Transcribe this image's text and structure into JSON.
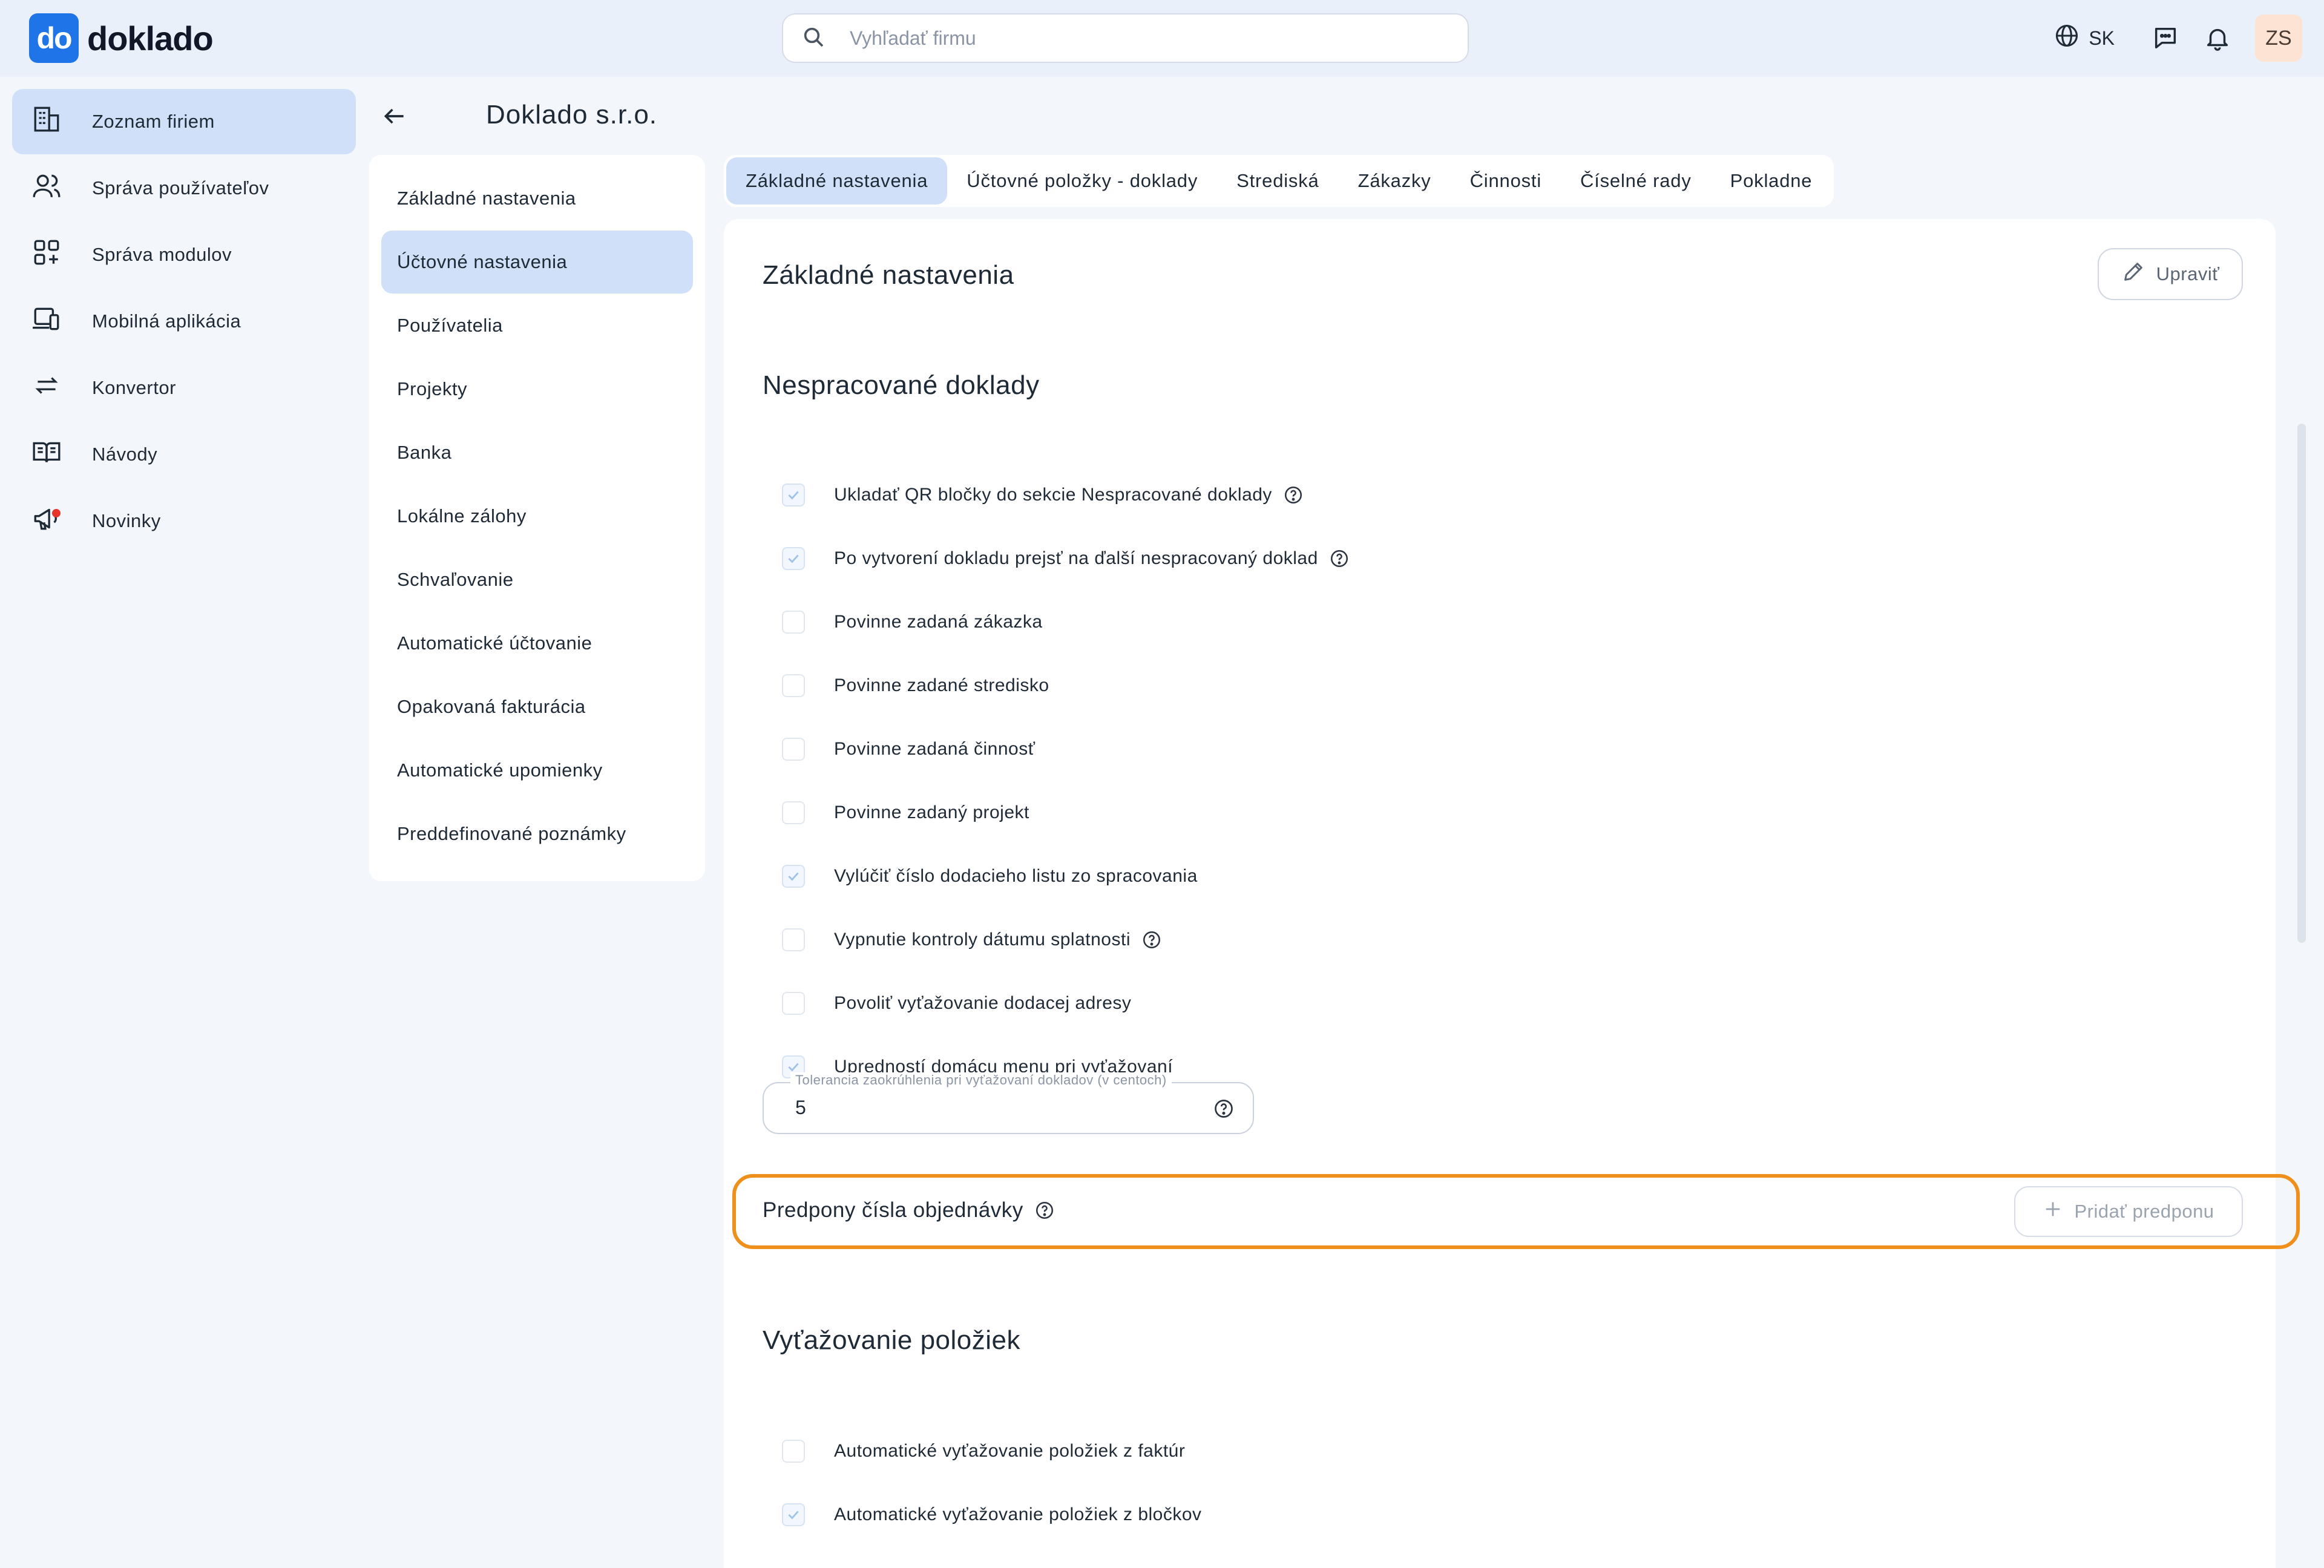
{
  "header": {
    "logo_mark": "do",
    "logo_text": "doklado",
    "search_placeholder": "Vyhľadať firmu",
    "language": "SK",
    "user_initials": "ZS",
    "icons": [
      "search-icon",
      "globe-icon",
      "chat-icon",
      "bell-icon"
    ]
  },
  "sidebar": {
    "items": [
      {
        "label": "Zoznam firiem",
        "icon": "building-icon",
        "active": true
      },
      {
        "label": "Správa používateľov",
        "icon": "users-icon"
      },
      {
        "label": "Správa modulov",
        "icon": "modules-icon"
      },
      {
        "label": "Mobilná aplikácia",
        "icon": "mobile-icon"
      },
      {
        "label": "Konvertor",
        "icon": "convert-icon"
      },
      {
        "label": "Návody",
        "icon": "book-icon"
      },
      {
        "label": "Novinky",
        "icon": "megaphone-icon"
      }
    ]
  },
  "page": {
    "title": "Doklado s.r.o."
  },
  "submenu": {
    "items": [
      "Základné nastavenia",
      "Účtovné nastavenia",
      "Používatelia",
      "Projekty",
      "Banka",
      "Lokálne zálohy",
      "Schvaľovanie",
      "Automatické účtovanie",
      "Opakovaná fakturácia",
      "Automatické upomienky",
      "Preddefinované poznámky"
    ],
    "active_index": 1
  },
  "tabs": {
    "items": [
      "Základné nastavenia",
      "Účtovné položky - doklady",
      "Strediská",
      "Zákazky",
      "Činnosti",
      "Číselné rady",
      "Pokladne"
    ],
    "active_index": 0
  },
  "main": {
    "title": "Základné nastavenia",
    "edit_label": "Upraviť",
    "unprocessed": {
      "title": "Nespracované doklady",
      "options": [
        {
          "label": "Ukladať QR bločky do sekcie Nespracované doklady",
          "checked": true,
          "help": true
        },
        {
          "label": "Po vytvorení dokladu prejsť na ďalší nespracovaný doklad",
          "checked": true,
          "help": true
        },
        {
          "label": "Povinne zadaná zákazka",
          "checked": false,
          "help": false
        },
        {
          "label": "Povinne zadané stredisko",
          "checked": false,
          "help": false
        },
        {
          "label": "Povinne zadaná činnosť",
          "checked": false,
          "help": false
        },
        {
          "label": "Povinne zadaný projekt",
          "checked": false,
          "help": false
        },
        {
          "label": "Vylúčiť číslo dodacieho listu zo spracovania",
          "checked": true,
          "help": false
        },
        {
          "label": "Vypnutie kontroly dátumu splatnosti",
          "checked": false,
          "help": true
        },
        {
          "label": "Povoliť vyťažovanie dodacej adresy",
          "checked": false,
          "help": false
        },
        {
          "label": "Upredností domácu menu pri vyťažovaní",
          "checked": true,
          "help": false
        }
      ],
      "tolerance_label": "Tolerancia zaokrúhlenia pri vyťažovaní dokladov (v centoch)",
      "tolerance_value": "5"
    },
    "prefix": {
      "title": "Predpony čísla objednávky",
      "add_label": "Pridať predponu"
    },
    "extraction": {
      "title": "Vyťažovanie položiek",
      "options": [
        {
          "label": "Automatické vyťažovanie položiek z faktúr",
          "checked": false
        },
        {
          "label": "Automatické vyťažovanie položiek z bločkov",
          "checked": true
        }
      ]
    }
  },
  "colors": {
    "accent": "#1f74e8",
    "active_bg": "#cfe0f8",
    "highlight": "#f0901c"
  }
}
